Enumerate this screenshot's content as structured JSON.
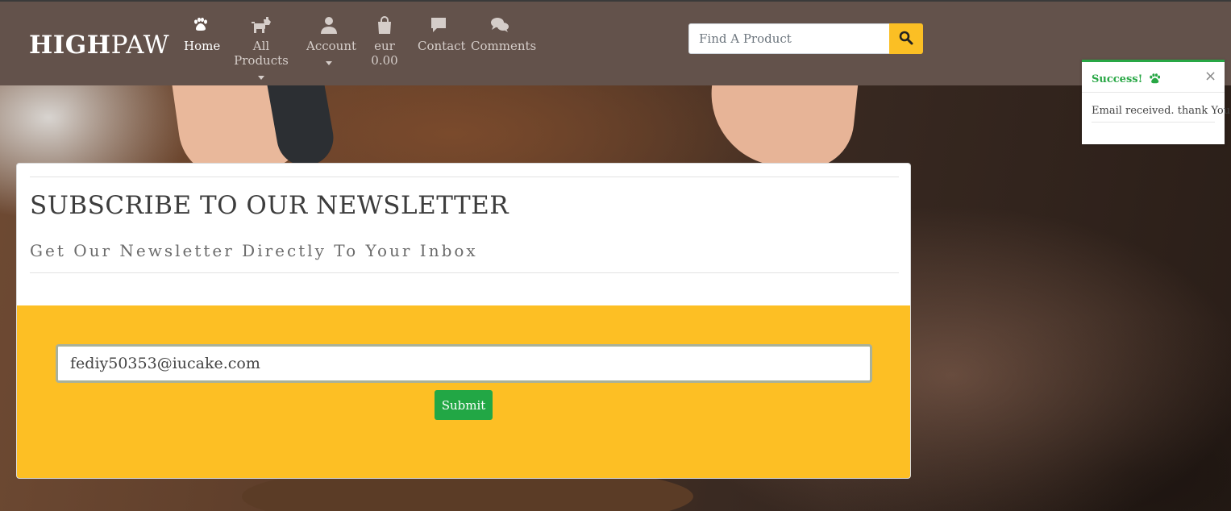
{
  "brand": {
    "bold": "HIGH",
    "light": "PAW"
  },
  "nav": {
    "home": "Home",
    "all_products": "All Products",
    "account": "Account",
    "bag_total": "eur 0.00",
    "contact": "Contact",
    "comments": "Comments"
  },
  "icons": {
    "home": "paw-icon",
    "all_products": "dog-icon",
    "account": "user-icon",
    "bag": "shopping-bag-icon",
    "contact": "comment-icon",
    "comments": "comments-icon",
    "search": "search-icon"
  },
  "search": {
    "placeholder": "Find A Product"
  },
  "newsletter": {
    "title": "SUBSCRIBE TO OUR NEWSLETTER",
    "subtitle": "Get Our Newsletter Directly To Your Inbox",
    "email_value": "fediy50353@iucake.com",
    "submit_label": "Submit"
  },
  "toast": {
    "title": "Success!",
    "close": "×",
    "message": "Email received. thank You!"
  },
  "colors": {
    "navbar": "#63524b",
    "accent": "#fdbf24",
    "success": "#28a745",
    "submit": "#22a745"
  }
}
